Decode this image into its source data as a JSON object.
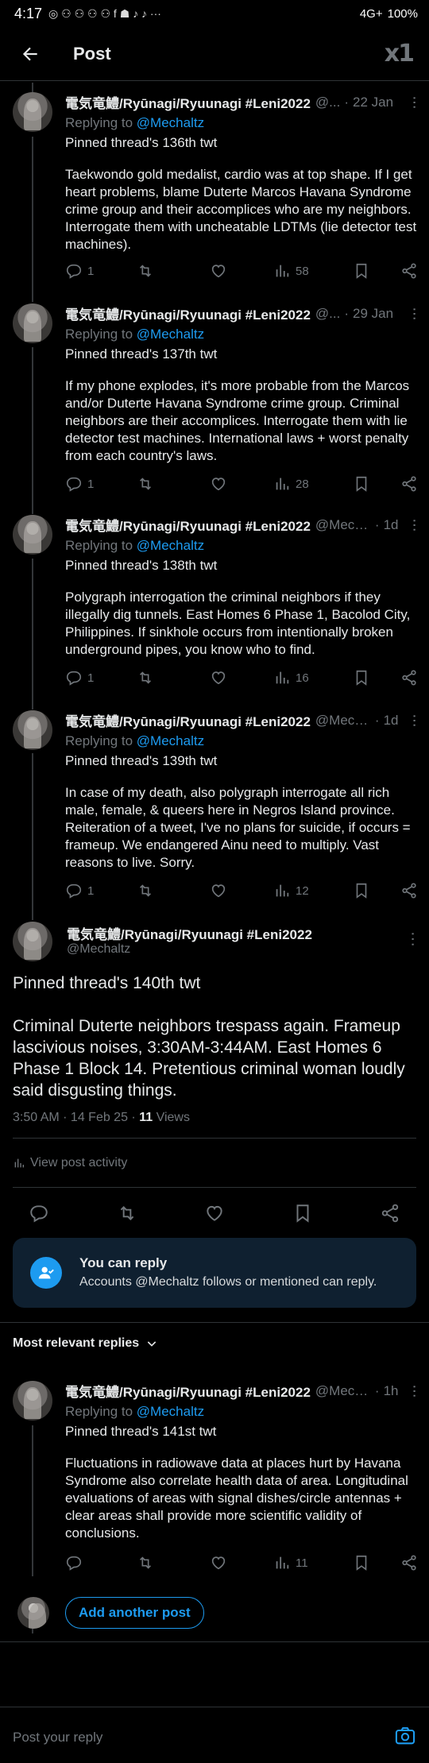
{
  "status_bar": {
    "time": "4:17",
    "app_icons": "◎ ⚇ ⚇ ⚇ ⚇ f ☗ ♪ ♪ ···",
    "battery": "100%",
    "signal": "4G+"
  },
  "header": {
    "title": "Post",
    "logo": "x1"
  },
  "author": {
    "name": "電気竜鱧/Ryūnagi/Ryuunagi #Leni2022",
    "handle": "@Mechaltz",
    "handle_trunc_a": "@...",
    "handle_trunc_b": "@Mech...",
    "replying_label": "Replying to",
    "replying_to": "@Mechaltz"
  },
  "thread_above": [
    {
      "handle": "@...",
      "time": "22 Jan",
      "title": "Pinned thread's 136th twt",
      "text": "Taekwondo gold medalist, cardio was at top shape. If I get heart problems, blame Duterte Marcos Havana Syndrome crime group and their accomplices who are my neighbors. Interrogate them with uncheatable LDTMs (lie detector test machines).",
      "replies": "1",
      "views": "58"
    },
    {
      "handle": "@...",
      "time": "29 Jan",
      "title": "Pinned thread's 137th twt",
      "text": "If my phone explodes, it's more probable from the Marcos and/or Duterte Havana Syndrome crime group. Criminal neighbors are their accomplices. Interrogate them with lie detector test machines. International laws + worst penalty from each country's laws.",
      "replies": "1",
      "views": "28"
    },
    {
      "handle": "@Mech...",
      "time": "1d",
      "title": "Pinned thread's 138th twt",
      "text": "Polygraph interrogation the criminal neighbors if they illegally dig tunnels. East Homes 6 Phase 1, Bacolod City, Philippines. If sinkhole occurs from intentionally broken underground pipes, you know who to find.",
      "replies": "1",
      "views": "16"
    },
    {
      "handle": "@Mech...",
      "time": "1d",
      "title": "Pinned thread's 139th twt",
      "text": "In case of my death, also polygraph interrogate all rich male, female, & queers here in Negros Island province. Reiteration of a tweet, I've no plans for suicide, if occurs = frameup. We endangered Ainu need to multiply. Vast reasons to live. Sorry.",
      "replies": "1",
      "views": "12"
    }
  ],
  "main_post": {
    "title": "Pinned thread's 140th twt",
    "text": "Criminal Duterte neighbors trespass again. Frameup lascivious noises, 3:30AM-3:44AM. East Homes 6 Phase 1 Block 14. Pretentious criminal woman loudly said disgusting things.",
    "time": "3:50 AM · 14 Feb 25 · ",
    "views_count": "11",
    "views_label": " Views",
    "activity": "View post activity"
  },
  "reply_card": {
    "title": "You can reply",
    "text": "Accounts @Mechaltz follows or mentioned can reply."
  },
  "sort_label": "Most relevant replies",
  "replies_below": [
    {
      "handle": "@Mech...",
      "time": "1h",
      "title": "Pinned thread's 141st twt",
      "text": "Fluctuations in radiowave data at places hurt by Havana Syndrome also correlate health data of area. Longitudinal evaluations of areas with signal dishes/circle antennas + clear areas shall provide more scientific validity of conclusions.",
      "views": "11"
    }
  ],
  "add_post_label": "Add another post",
  "composer_placeholder": "Post your reply",
  "colors": {
    "background": "#000000",
    "accent": "#1d9bf0",
    "muted": "#71767b",
    "text": "#e7e9ea"
  }
}
